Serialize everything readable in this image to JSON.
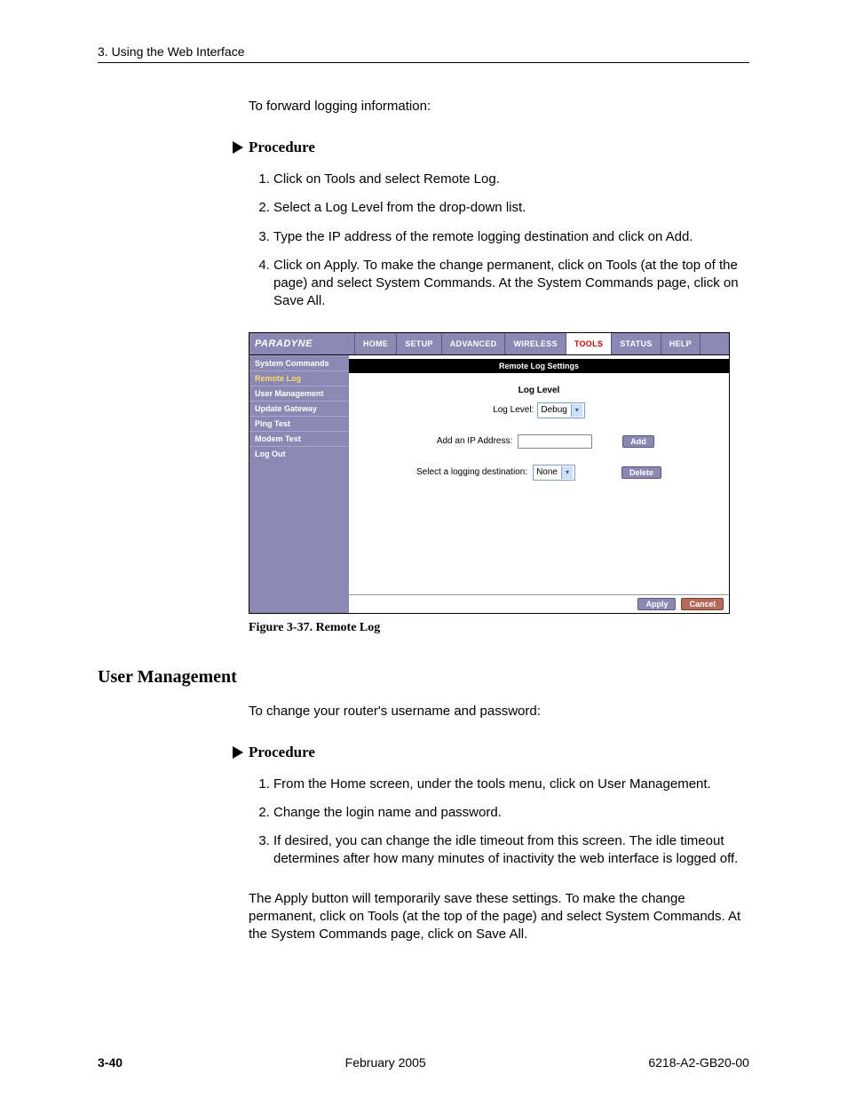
{
  "header": {
    "chapter": "3. Using the Web Interface"
  },
  "intro1": "To forward logging information:",
  "procedure_label": "Procedure",
  "steps1": [
    "Click on Tools and select Remote Log.",
    "Select a Log Level from the drop-down list.",
    "Type the IP address of the remote logging destination and click on Add.",
    "Click on Apply. To make the change permanent, click on Tools (at the top of the page) and select System Commands. At the System Commands page, click on Save All."
  ],
  "figure_caption": "Figure 3-37.   Remote Log",
  "screenshot": {
    "brand": "PARADYNE",
    "tabs": [
      "HOME",
      "SETUP",
      "ADVANCED",
      "WIRELESS",
      "TOOLS",
      "STATUS",
      "HELP"
    ],
    "active_tab": "TOOLS",
    "sidebar": [
      "System Commands",
      "Remote Log",
      "User Management",
      "Update Gateway",
      "Ping Test",
      "Modem Test",
      "Log Out"
    ],
    "sidebar_active": "Remote Log",
    "panel_title": "Remote Log Settings",
    "section_title": "Log Level",
    "log_level_label": "Log Level:",
    "log_level_value": "Debug",
    "add_ip_label": "Add an IP Address:",
    "add_btn": "Add",
    "dest_label": "Select a logging destination:",
    "dest_value": "None",
    "delete_btn": "Delete",
    "apply_btn": "Apply",
    "cancel_btn": "Cancel"
  },
  "section2_heading": "User Management",
  "intro2": "To change your router's username and password:",
  "steps2": [
    "From the Home screen, under the tools menu, click on User Management.",
    "Change the login name and password.",
    "If desired, you can change the idle timeout from this screen. The idle timeout determines after how many minutes of inactivity the web interface is logged off."
  ],
  "closing_para": "The Apply button will temporarily save these settings. To make the change permanent,  click on Tools (at the top of the page) and select System Commands. At the System Commands page, click on Save All.",
  "footer": {
    "page": "3-40",
    "date": "February 2005",
    "doc": "6218-A2-GB20-00"
  }
}
